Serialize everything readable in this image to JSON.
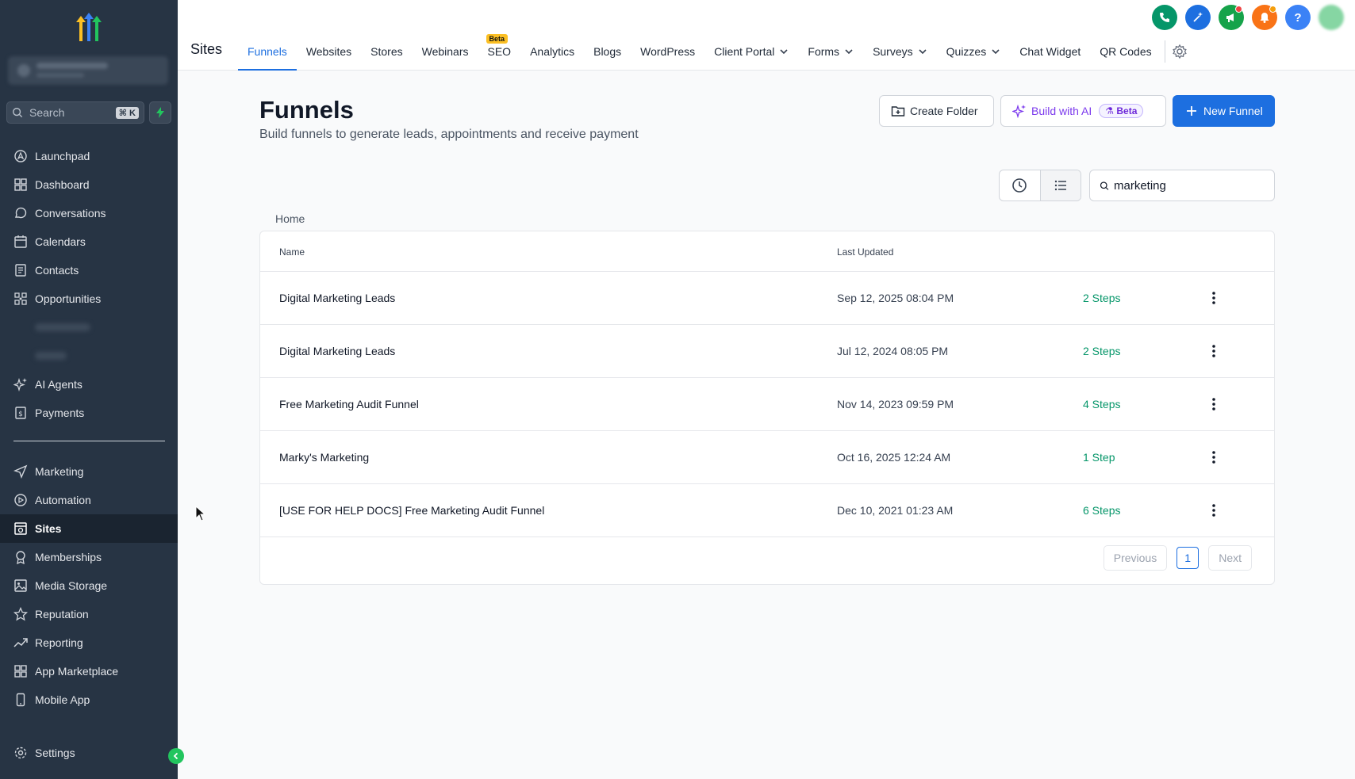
{
  "sidebar": {
    "search_placeholder": "Search",
    "search_shortcut": "⌘ K",
    "items": [
      {
        "label": "Launchpad",
        "icon": "rocket-icon"
      },
      {
        "label": "Dashboard",
        "icon": "grid-icon"
      },
      {
        "label": "Conversations",
        "icon": "chat-icon"
      },
      {
        "label": "Calendars",
        "icon": "calendar-icon"
      },
      {
        "label": "Contacts",
        "icon": "contacts-icon"
      },
      {
        "label": "Opportunities",
        "icon": "opportunities-icon"
      }
    ],
    "items_b": [
      {
        "label": "AI Agents",
        "icon": "sparkle-icon"
      },
      {
        "label": "Payments",
        "icon": "payments-icon"
      }
    ],
    "items_c": [
      {
        "label": "Marketing",
        "icon": "send-icon"
      },
      {
        "label": "Automation",
        "icon": "automation-icon"
      },
      {
        "label": "Sites",
        "icon": "sites-icon"
      },
      {
        "label": "Memberships",
        "icon": "award-icon"
      },
      {
        "label": "Media Storage",
        "icon": "image-icon"
      },
      {
        "label": "Reputation",
        "icon": "star-icon"
      },
      {
        "label": "Reporting",
        "icon": "trend-icon"
      },
      {
        "label": "App Marketplace",
        "icon": "apps-icon"
      },
      {
        "label": "Mobile App",
        "icon": "phone-device-icon"
      }
    ],
    "settings_label": "Settings",
    "active": "Sites"
  },
  "topbar": {
    "section_title": "Sites",
    "tabs": [
      {
        "label": "Funnels",
        "active": true
      },
      {
        "label": "Websites"
      },
      {
        "label": "Stores"
      },
      {
        "label": "Webinars"
      },
      {
        "label": "SEO",
        "badge": "Beta"
      },
      {
        "label": "Analytics"
      },
      {
        "label": "Blogs"
      },
      {
        "label": "WordPress"
      },
      {
        "label": "Client Portal",
        "dropdown": true
      },
      {
        "label": "Forms",
        "dropdown": true
      },
      {
        "label": "Surveys",
        "dropdown": true
      },
      {
        "label": "Quizzes",
        "dropdown": true
      },
      {
        "label": "Chat Widget"
      },
      {
        "label": "QR Codes"
      }
    ],
    "help_glyph": "?"
  },
  "main": {
    "title": "Funnels",
    "subtitle": "Build funnels to generate leads, appointments and receive payment",
    "create_folder": "Create Folder",
    "build_ai": "Build with AI",
    "build_ai_badge": "Beta",
    "new_funnel": "New Funnel",
    "search_value": "marketing",
    "breadcrumb": "Home",
    "table": {
      "col_name": "Name",
      "col_updated": "Last Updated",
      "rows": [
        {
          "name": "Digital Marketing Leads",
          "updated": "Sep 12, 2025 08:04 PM",
          "steps": "2 Steps"
        },
        {
          "name": "Digital Marketing Leads",
          "updated": "Jul 12, 2024 08:05 PM",
          "steps": "2 Steps"
        },
        {
          "name": "Free Marketing Audit Funnel",
          "updated": "Nov 14, 2023 09:59 PM",
          "steps": "4 Steps"
        },
        {
          "name": "Marky's Marketing",
          "updated": "Oct 16, 2025 12:24 AM",
          "steps": "1 Step"
        },
        {
          "name": "[USE FOR HELP DOCS] Free Marketing Audit Funnel",
          "updated": "Dec 10, 2021 01:23 AM",
          "steps": "6 Steps"
        }
      ]
    },
    "pagination": {
      "previous": "Previous",
      "page": "1",
      "next": "Next"
    }
  },
  "colors": {
    "sidebar_bg": "#273444",
    "accent": "#1d6fe0",
    "steps_green": "#059669",
    "ai_purple": "#7c3aed"
  }
}
